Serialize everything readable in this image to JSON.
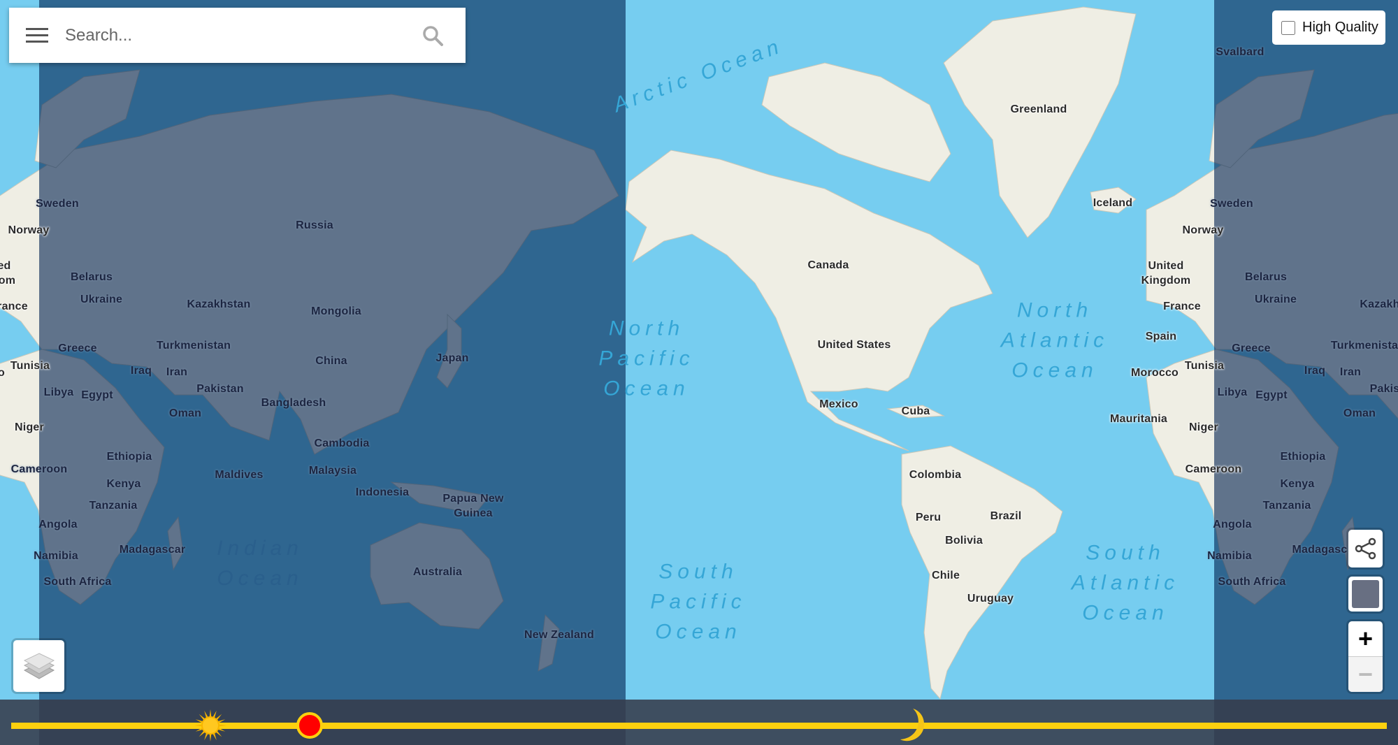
{
  "search": {
    "placeholder": "Search...",
    "menu_icon": "hamburger-menu-icon",
    "search_icon": "magnifier-icon"
  },
  "quality_toggle": {
    "label": "High Quality",
    "checked": false
  },
  "controls": {
    "share_icon": "share-icon",
    "layers_icon": "layers-icon",
    "zoom_in": "+",
    "zoom_out": "−",
    "swatch_color": "#686f82"
  },
  "colors": {
    "water": "#76cdf0",
    "land": "#efeee4",
    "night_overlay": "rgba(0,33,80,0.6)",
    "timeline_track": "#fcd00f",
    "current_time_marker": "#ff0000"
  },
  "timeline": {
    "current_position": 0.217,
    "sun_position": 0.145,
    "moon_position": 0.653,
    "sun_icon": "sun-icon",
    "moon_icon": "crescent-moon-icon"
  },
  "map": {
    "labels": [
      "Greenland",
      "Iceland",
      "Canada",
      "United States",
      "Mexico",
      "Cuba",
      "Colombia",
      "Peru",
      "Brazil",
      "Bolivia",
      "Chile",
      "Uruguay",
      "Sweden",
      "Norway",
      "Russia",
      "Belarus",
      "Ukraine",
      "Kazakhstan",
      "Mongolia",
      "Greece",
      "Turkmenistan",
      "Tunisia",
      "Iraq",
      "Iran",
      "China",
      "Japan",
      "Pakistan",
      "Libya",
      "Egypt",
      "Oman",
      "Bangladesh",
      "Niger",
      "Ethiopia",
      "Cambodia",
      "Cameroon",
      "Malaysia",
      "Maldives",
      "Kenya",
      "Indonesia",
      "Papua New",
      "Guinea",
      "Tanzania",
      "Angola",
      "Madagascar",
      "Namibia",
      "Australia",
      "South Africa",
      "New Zealand",
      "Svalbard",
      "Sweden",
      "Norway",
      "United",
      "Kingdom",
      "Belarus",
      "Ukraine",
      "Kazakh",
      "France",
      "Spain",
      "Greece",
      "Turkmenista",
      "Tunisia",
      "Morocco",
      "Iraq",
      "Iran",
      "Libya",
      "Egypt",
      "Pakis",
      "Oman",
      "Mauritania",
      "Niger",
      "Ethiopia",
      "Cameroon",
      "Kenya",
      "Tanzania",
      "Angola",
      "Madagasc",
      "Namibia",
      "South Africa",
      "ed",
      "om",
      "rance",
      "o"
    ],
    "oceans": [
      {
        "lines": [
          "Arctic Ocean"
        ]
      },
      {
        "lines": [
          "North",
          "Pacific",
          "Ocean"
        ]
      },
      {
        "lines": [
          "North",
          "Atlantic",
          "Ocean"
        ]
      },
      {
        "lines": [
          "Indian",
          "Ocean"
        ]
      },
      {
        "lines": [
          "South",
          "Pacific",
          "Ocean"
        ]
      },
      {
        "lines": [
          "South",
          "Atlantic",
          "Ocean"
        ]
      }
    ]
  }
}
